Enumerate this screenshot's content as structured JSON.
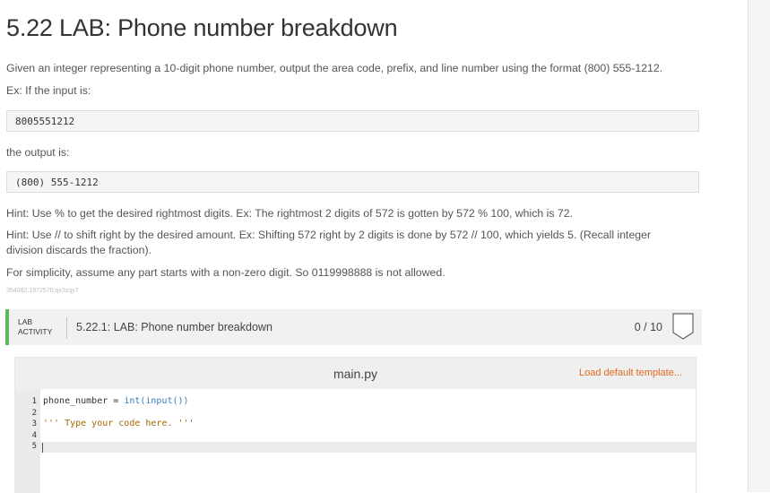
{
  "page": {
    "title": "5.22 LAB: Phone number breakdown",
    "intro": "Given an integer representing a 10-digit phone number, output the area code, prefix, and line number using the format (800) 555-1212.",
    "example_label": "Ex: If the input is:",
    "example_input": "8005551212",
    "output_label": "the output is:",
    "example_output": "(800) 555-1212",
    "hint1": "Hint: Use % to get the desired rightmost digits. Ex: The rightmost 2 digits of 572 is gotten by 572 % 100, which is 72.",
    "hint2": "Hint: Use // to shift right by the desired amount. Ex: Shifting 572 right by 2 digits is done by 572 // 100, which yields 5. (Recall integer division discards the fraction).",
    "note": "For simplicity, assume any part starts with a non-zero digit. So 0119998888 is not allowed.",
    "ref_id": "354082.1972570.qx3zqy7"
  },
  "lab": {
    "tag_line1": "LAB",
    "tag_line2": "ACTIVITY",
    "title": "5.22.1: LAB: Phone number breakdown",
    "score": "0 / 10",
    "accent_color": "#5cb85c"
  },
  "editor": {
    "file_name": "main.py",
    "load_template": "Load default template...",
    "load_color": "#e2681f",
    "line_numbers": [
      "1",
      "2",
      "3",
      "4",
      "5"
    ],
    "lines": {
      "l1_var": "phone_number = ",
      "l1_call": "int(input())",
      "l3": "''' Type your code here. '''"
    }
  }
}
